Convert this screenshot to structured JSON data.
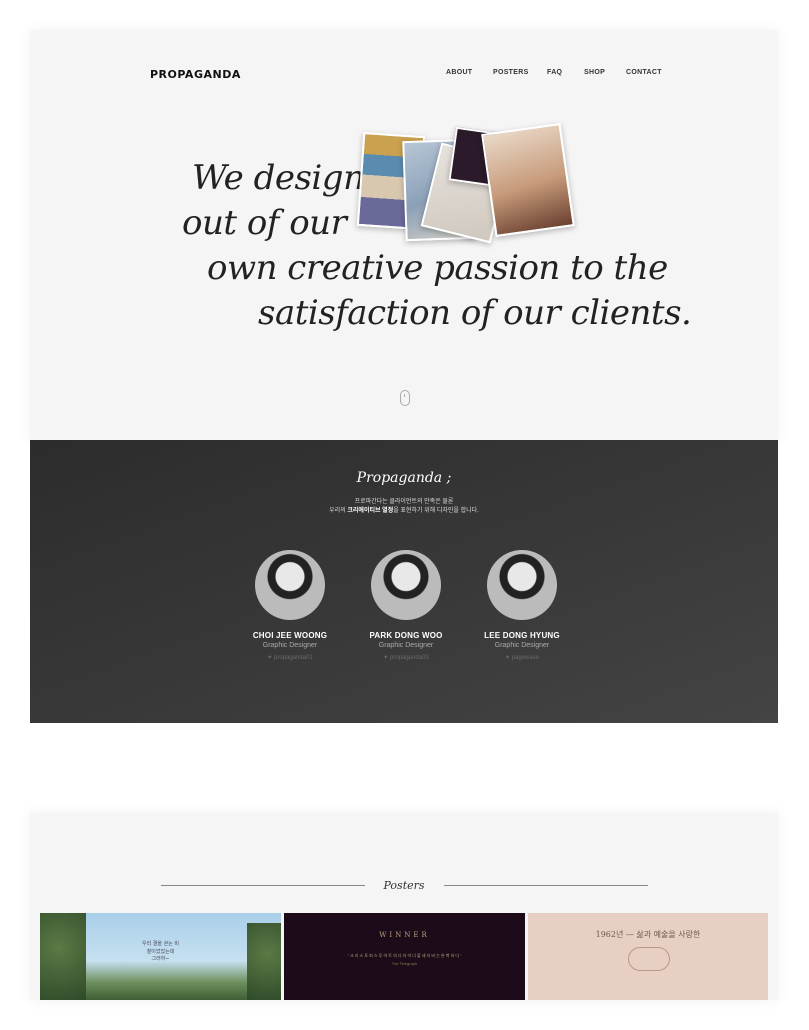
{
  "header": {
    "logo": "PROPAGANDA",
    "nav": [
      "ABOUT",
      "POSTERS",
      "FAQ",
      "SHOP",
      "CONTACT"
    ]
  },
  "hero": {
    "lines": [
      "We design",
      "out of our",
      "own creative passion to the",
      "satisfaction of our clients."
    ]
  },
  "team": {
    "title": "Propaganda ;",
    "desc_line1": "프로파간다는 클라이언트의 만족은 물론",
    "desc_line2_pre": "우리의 ",
    "desc_line2_bold": "크리에이티브 열정",
    "desc_line2_post": "을 표현하기 위해 디자인을 합니다.",
    "members": [
      {
        "name": "CHOI JEE WOONG",
        "role": "Graphic Designer",
        "handle": "propaganda01"
      },
      {
        "name": "PARK DONG WOO",
        "role": "Graphic Designer",
        "handle": "propaganda03"
      },
      {
        "name": "LEE DONG HYUNG",
        "role": "Graphic Designer",
        "handle": "pagewave"
      }
    ]
  },
  "posters": {
    "title": "Posters",
    "items": [
      {
        "text": "우리 결을 걷는 비\n찰이었었는데\n그러하~"
      },
      {
        "text": "WINNER",
        "sub": "\" 크 리 스 토 퍼  스 투 어 트 의  디 자 이 너   불 세 자 비 는  완 벽 하 다 \"",
        "credit": "The Telegraph"
      },
      {
        "text": "1962년 — 삶과 예술을 사랑한"
      }
    ]
  },
  "colors": {
    "panel_bg": "#f5f5f5",
    "team_bg": "#333333",
    "poster2_bg": "#1d0b1a",
    "poster3_bg": "#e8cfc3"
  }
}
